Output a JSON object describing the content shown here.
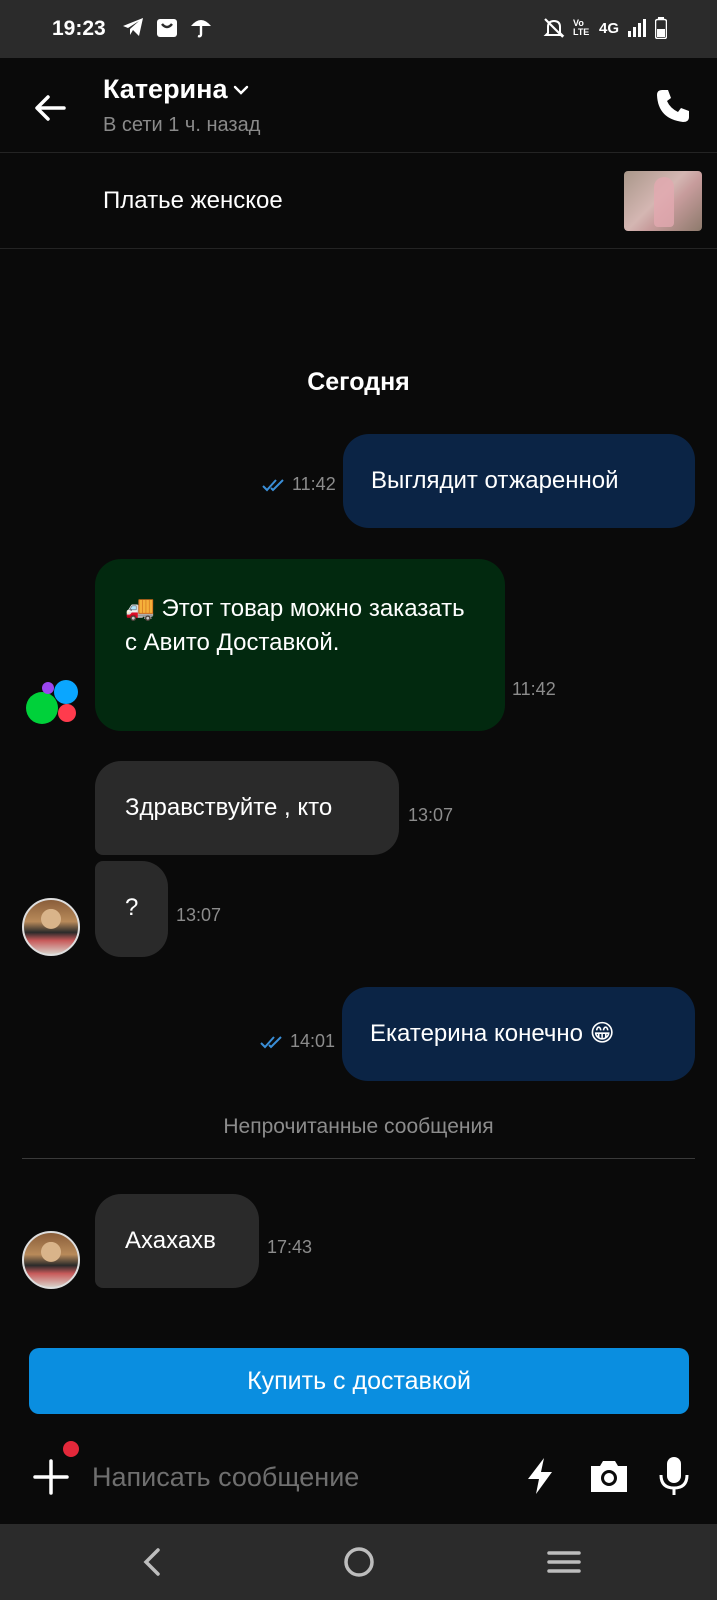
{
  "status_bar": {
    "time": "19:23",
    "icons_left": [
      "telegram-icon",
      "shopping-bag-icon",
      "umbrella-icon"
    ],
    "icons_right": [
      "mute-icon",
      "volte-icon",
      "4g-icon",
      "signal-icon",
      "battery-icon"
    ],
    "net_label": "4G",
    "volte_label": "Vo LTE"
  },
  "header": {
    "contact_name": "Катерина",
    "status": "В сети 1 ч. назад"
  },
  "product": {
    "title": "Платье женское"
  },
  "chat": {
    "date_separator": "Сегодня",
    "messages": [
      {
        "text": "Выглядит отжаренной",
        "time": "11:42"
      },
      {
        "text": "🚚 Этот товар можно заказать с Авито Доставкой.",
        "time": "11:42"
      },
      {
        "text": "Здравствуйте , кто",
        "time": "13:07"
      },
      {
        "text": "?",
        "time": "13:07"
      },
      {
        "text": "Екатерина конечно 😁",
        "time": "14:01"
      },
      {
        "text": "Ахахахв",
        "time": "17:43"
      }
    ],
    "unread_label": "Непрочитанные сообщения"
  },
  "buy_button": {
    "label": "Купить с доставкой"
  },
  "composer": {
    "placeholder": "Написать сообщение"
  },
  "colors": {
    "outgoing_bubble": "#0b2445",
    "incoming_bubble": "#2a2a2a",
    "system_bubble": "#02290f",
    "buy_button": "#0a8ee0",
    "read_check": "#3a8fd8"
  }
}
